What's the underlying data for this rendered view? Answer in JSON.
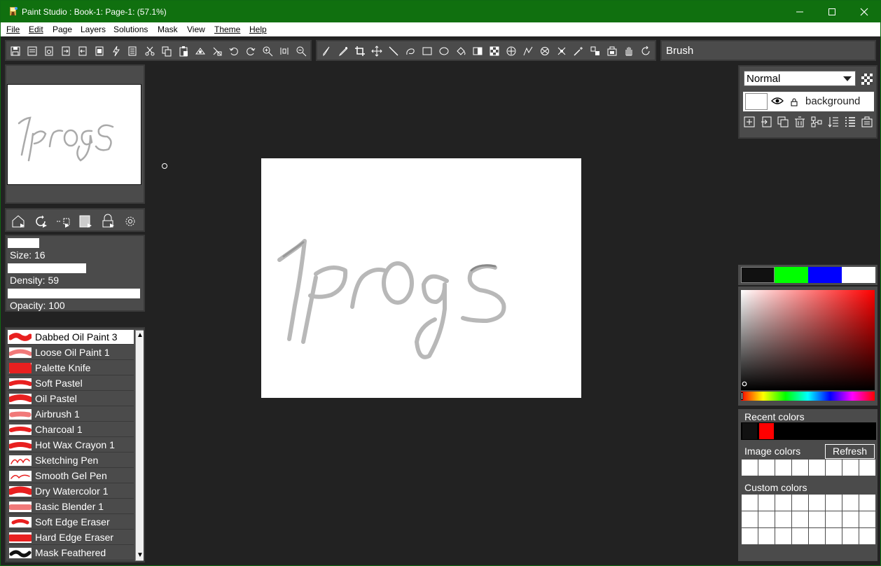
{
  "window": {
    "title": "Paint Studio : Book-1: Page-1:  (57.1%)"
  },
  "menu": [
    "File",
    "Edit",
    "Page",
    "Layers",
    "Solutions",
    "Mask",
    "View",
    "Theme",
    "Help"
  ],
  "tool_name": "Brush",
  "sliders": {
    "size": {
      "label": "Size: 16",
      "fraction": 0.24
    },
    "density": {
      "label": "Density: 59",
      "fraction": 0.59
    },
    "opacity": {
      "label": "Opacity: 100",
      "fraction": 1.0
    }
  },
  "brushes": [
    "Dabbed Oil Paint 3",
    "Loose Oil Paint 1",
    "Palette Knife",
    "Soft Pastel",
    "Oil Pastel",
    "Airbrush 1",
    "Charcoal 1",
    "Hot Wax Crayon 1",
    "Sketching Pen",
    "Smooth Gel Pen",
    "Dry Watercolor 1",
    "Basic Blender 1",
    "Soft Edge Eraser",
    "Hard Edge Eraser",
    "Mask Feathered"
  ],
  "selected_brush": "Dabbed Oil Paint 3",
  "layers": {
    "blend_mode": "Normal",
    "layer_name": "background"
  },
  "color_swatches": [
    "#111111",
    "#00ff00",
    "#0000ff",
    "#ffffff"
  ],
  "recent_colors": {
    "label": "Recent colors",
    "colors": [
      "#111111",
      "#ff0000"
    ]
  },
  "image_colors": {
    "label": "Image colors",
    "refresh_label": "Refresh"
  },
  "custom_colors": {
    "label": "Custom colors"
  },
  "canvas": {
    "text_drawn": "1progs"
  },
  "icons": {
    "app": "paint-icon",
    "window_controls": [
      "minimize-icon",
      "maximize-icon",
      "close-icon"
    ]
  }
}
